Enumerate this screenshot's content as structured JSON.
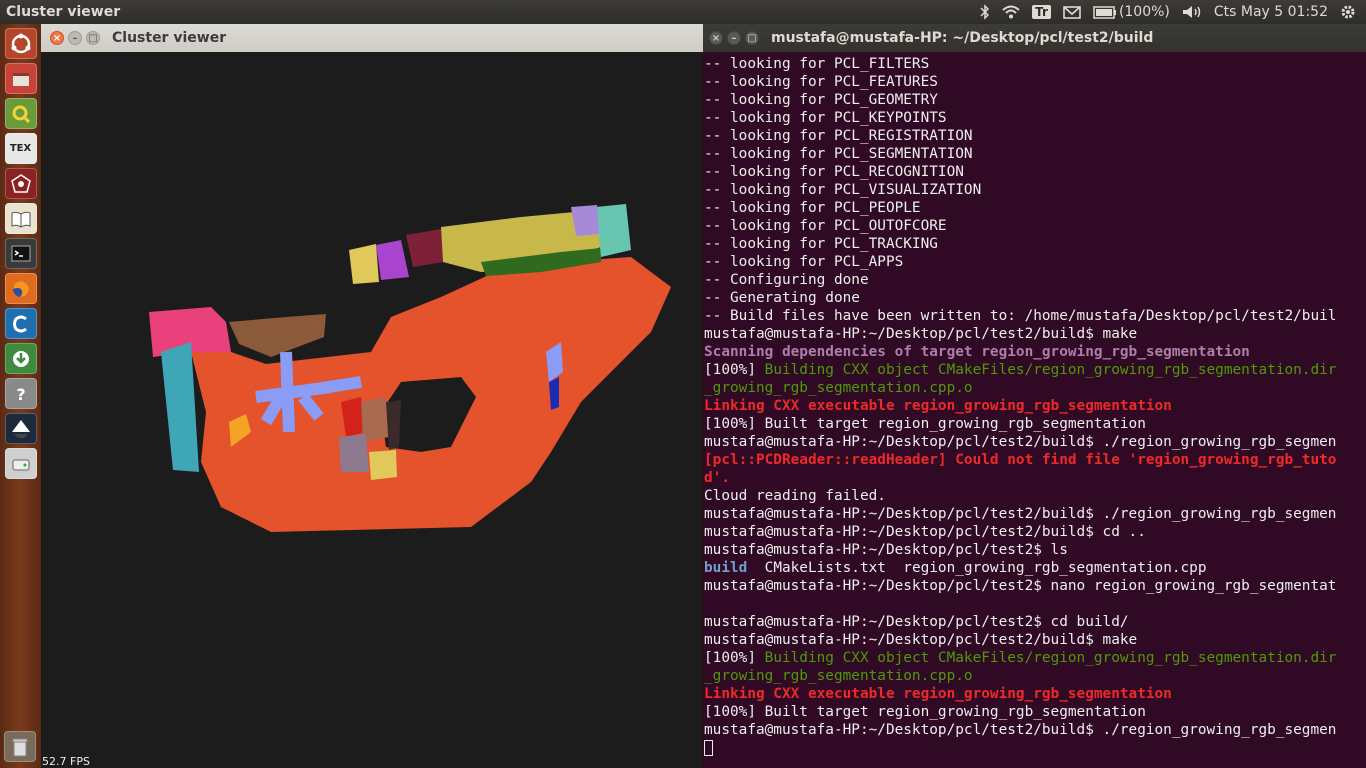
{
  "topbar": {
    "app_title": "Cluster viewer",
    "icons": [
      "bluetooth-icon",
      "wifi-icon",
      "keyboard-layout-icon",
      "mail-icon",
      "battery-icon",
      "volume-icon",
      "gear-icon"
    ],
    "keyboard_layout": "Tr",
    "battery": "(100%)",
    "clock": "Cts May  5 01:52"
  },
  "launcher": {
    "items": [
      "ubuntu-home-icon",
      "files-icon",
      "qgis-icon",
      "tex-icon",
      "network-icon",
      "book-icon",
      "terminal-icon",
      "firefox-icon",
      "ccleaner-icon",
      "software-updater-icon",
      "help-icon",
      "inkscape-icon",
      "drive-icon",
      "trash-icon"
    ],
    "tex_label": "TEX"
  },
  "viewer": {
    "title": "Cluster viewer",
    "fps": "52.7 FPS",
    "colors": {
      "floor": "#e4532b",
      "pink": "#e8417b",
      "cyan": "#3fa6b8",
      "brown": "#8b5a3a",
      "blue": "#8a9cf5",
      "yellow": "#e0c85a",
      "purple": "#a944cc",
      "olive": "#c8b84a",
      "darkgreen": "#2f6a1e",
      "teal": "#66c6b0",
      "maroon": "#7d2038",
      "orange": "#f5a325",
      "red": "#d3221c",
      "darkblue": "#1b2bb4"
    }
  },
  "terminal": {
    "title": "mustafa@mustafa-HP: ~/Desktop/pcl/test2/build",
    "lines": [
      [
        {
          "t": "-- looking for PCL_FILTERS",
          "c": ""
        }
      ],
      [
        {
          "t": "-- looking for PCL_FEATURES",
          "c": ""
        }
      ],
      [
        {
          "t": "-- looking for PCL_GEOMETRY",
          "c": ""
        }
      ],
      [
        {
          "t": "-- looking for PCL_KEYPOINTS",
          "c": ""
        }
      ],
      [
        {
          "t": "-- looking for PCL_REGISTRATION",
          "c": ""
        }
      ],
      [
        {
          "t": "-- looking for PCL_SEGMENTATION",
          "c": ""
        }
      ],
      [
        {
          "t": "-- looking for PCL_RECOGNITION",
          "c": ""
        }
      ],
      [
        {
          "t": "-- looking for PCL_VISUALIZATION",
          "c": ""
        }
      ],
      [
        {
          "t": "-- looking for PCL_PEOPLE",
          "c": ""
        }
      ],
      [
        {
          "t": "-- looking for PCL_OUTOFCORE",
          "c": ""
        }
      ],
      [
        {
          "t": "-- looking for PCL_TRACKING",
          "c": ""
        }
      ],
      [
        {
          "t": "-- looking for PCL_APPS",
          "c": ""
        }
      ],
      [
        {
          "t": "-- Configuring done",
          "c": ""
        }
      ],
      [
        {
          "t": "-- Generating done",
          "c": ""
        }
      ],
      [
        {
          "t": "-- Build files have been written to: /home/mustafa/Desktop/pcl/test2/buil",
          "c": ""
        }
      ],
      [
        {
          "t": "mustafa@mustafa-HP:~/Desktop/pcl/test2/build$ make",
          "c": ""
        }
      ],
      [
        {
          "t": "Scanning dependencies of target region_growing_rgb_segmentation",
          "c": "c-purple"
        }
      ],
      [
        {
          "t": "[100%] ",
          "c": ""
        },
        {
          "t": "Building CXX object CMakeFiles/region_growing_rgb_segmentation.dir",
          "c": "c-green"
        }
      ],
      [
        {
          "t": "_growing_rgb_segmentation.cpp.o",
          "c": "c-green"
        }
      ],
      [
        {
          "t": "Linking CXX executable region_growing_rgb_segmentation",
          "c": "c-red"
        }
      ],
      [
        {
          "t": "[100%] Built target region_growing_rgb_segmentation",
          "c": ""
        }
      ],
      [
        {
          "t": "mustafa@mustafa-HP:~/Desktop/pcl/test2/build$ ./region_growing_rgb_segmen",
          "c": ""
        }
      ],
      [
        {
          "t": "[pcl::PCDReader::readHeader] Could not find file 'region_growing_rgb_tuto",
          "c": "c-red"
        }
      ],
      [
        {
          "t": "d'.",
          "c": "c-red"
        }
      ],
      [
        {
          "t": "Cloud reading failed.",
          "c": ""
        }
      ],
      [
        {
          "t": "mustafa@mustafa-HP:~/Desktop/pcl/test2/build$ ./region_growing_rgb_segmen",
          "c": ""
        }
      ],
      [
        {
          "t": "mustafa@mustafa-HP:~/Desktop/pcl/test2/build$ cd ..",
          "c": ""
        }
      ],
      [
        {
          "t": "mustafa@mustafa-HP:~/Desktop/pcl/test2$ ls",
          "c": ""
        }
      ],
      [
        {
          "t": "build",
          "c": "c-blue"
        },
        {
          "t": "  CMakeLists.txt  region_growing_rgb_segmentation.cpp",
          "c": ""
        }
      ],
      [
        {
          "t": "mustafa@mustafa-HP:~/Desktop/pcl/test2$ nano region_growing_rgb_segmentat",
          "c": ""
        }
      ],
      [
        {
          "t": "",
          "c": ""
        }
      ],
      [
        {
          "t": "mustafa@mustafa-HP:~/Desktop/pcl/test2$ cd build/",
          "c": ""
        }
      ],
      [
        {
          "t": "mustafa@mustafa-HP:~/Desktop/pcl/test2/build$ make",
          "c": ""
        }
      ],
      [
        {
          "t": "[100%] ",
          "c": ""
        },
        {
          "t": "Building CXX object CMakeFiles/region_growing_rgb_segmentation.dir",
          "c": "c-green"
        }
      ],
      [
        {
          "t": "_growing_rgb_segmentation.cpp.o",
          "c": "c-green"
        }
      ],
      [
        {
          "t": "Linking CXX executable region_growing_rgb_segmentation",
          "c": "c-red"
        }
      ],
      [
        {
          "t": "[100%] Built target region_growing_rgb_segmentation",
          "c": ""
        }
      ],
      [
        {
          "t": "mustafa@mustafa-HP:~/Desktop/pcl/test2/build$ ./region_growing_rgb_segmen",
          "c": ""
        }
      ]
    ]
  }
}
